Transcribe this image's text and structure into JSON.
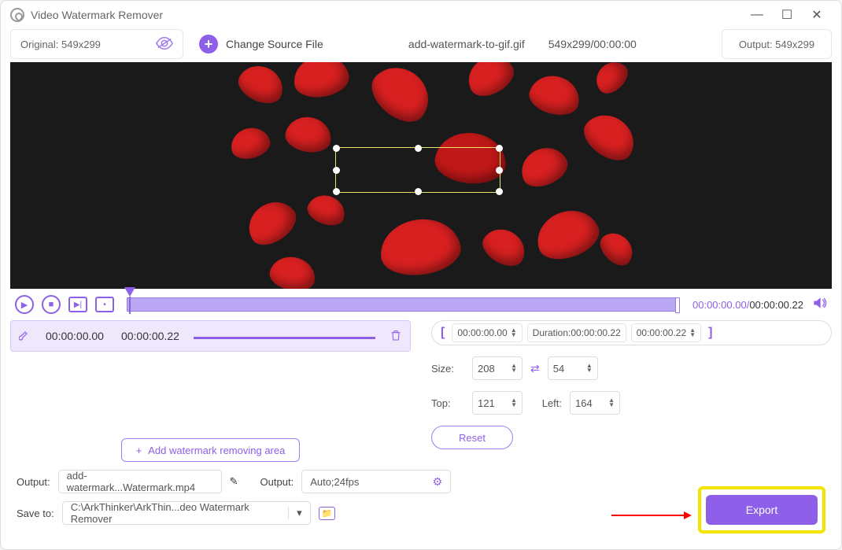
{
  "app": {
    "title": "Video Watermark Remover"
  },
  "toolbar": {
    "original_label": "Original: 549x299",
    "change_source": "Change Source File",
    "source_file": "add-watermark-to-gif.gif",
    "source_dims_time": "549x299/00:00:00",
    "output_label": "Output: 549x299"
  },
  "transport": {
    "current": "00:00:00.00",
    "total": "00:00:00.22"
  },
  "segment": {
    "start": "00:00:00.00",
    "end": "00:00:00.22"
  },
  "range": {
    "start": "00:00:00.00",
    "duration_label": "Duration:00:00:00.22",
    "end": "00:00:00.22"
  },
  "params": {
    "size_label": "Size:",
    "width": "208",
    "height": "54",
    "top_label": "Top:",
    "top": "121",
    "left_label": "Left:",
    "left": "164"
  },
  "buttons": {
    "add_area": "Add watermark removing area",
    "reset": "Reset",
    "export": "Export"
  },
  "bottom": {
    "output_label": "Output:",
    "output_file": "add-watermark...Watermark.mp4",
    "output2_label": "Output:",
    "output_fmt": "Auto;24fps",
    "saveto_label": "Save to:",
    "saveto_path": "C:\\ArkThinker\\ArkThin...deo Watermark Remover"
  }
}
